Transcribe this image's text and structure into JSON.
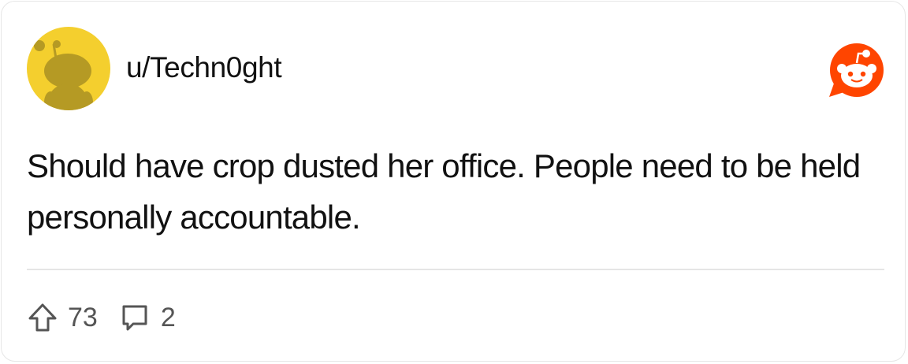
{
  "post": {
    "username": "u/Techn0ght",
    "body": "Should have crop dusted her office. People need to be held personally accountable.",
    "upvotes": "73",
    "comments": "2"
  },
  "icons": {
    "avatar": "snoo-avatar-icon",
    "brand": "reddit-logo-icon",
    "upvote": "upvote-arrow-icon",
    "comment": "comment-bubble-icon"
  },
  "colors": {
    "avatar_bg": "#F4CF2E",
    "avatar_snoo": "#B59A24",
    "brand": "#FF4500",
    "text": "#111111",
    "muted": "#555555"
  }
}
